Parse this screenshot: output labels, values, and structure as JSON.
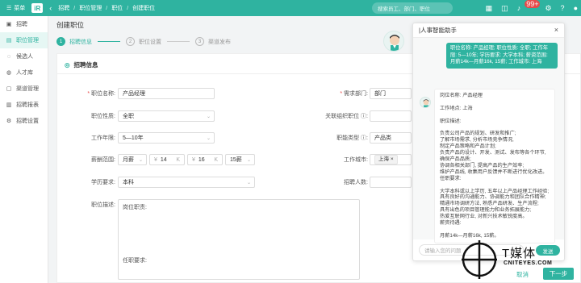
{
  "topbar": {
    "menu_label": "菜单",
    "logo_text": "iR",
    "breadcrumbs": [
      "招聘",
      "职位管理",
      "职位",
      "创建职位"
    ],
    "search_placeholder": "搜索员工、部门、职位",
    "notification_count": "99+"
  },
  "sidebar": {
    "items": [
      {
        "label": "招聘",
        "icon": "briefcase-icon"
      },
      {
        "label": "职位管理",
        "icon": "document-icon",
        "active": true
      },
      {
        "label": "候选人",
        "icon": "user-icon"
      },
      {
        "label": "人才库",
        "icon": "users-icon"
      },
      {
        "label": "渠道管理",
        "icon": "channel-icon"
      },
      {
        "label": "招聘报表",
        "icon": "chart-icon"
      },
      {
        "label": "招聘设置",
        "icon": "gear-icon"
      }
    ]
  },
  "page": {
    "title": "创建职位",
    "steps": [
      {
        "num": "1",
        "label": "招聘信息"
      },
      {
        "num": "2",
        "label": "职位设置"
      },
      {
        "num": "3",
        "label": "渠道发布"
      }
    ]
  },
  "form": {
    "section_title": "招聘信息",
    "job_name": {
      "label": "职位名称:",
      "value": "产品经理"
    },
    "department": {
      "label": "需求部门:",
      "value": "部门"
    },
    "job_nature": {
      "label": "职位性质:",
      "value": "全职"
    },
    "related_org": {
      "label": "关联组织职位",
      "value": ""
    },
    "experience": {
      "label": "工作年限:",
      "value": "5—10年"
    },
    "job_type": {
      "label": "职能类型",
      "value": "产品类"
    },
    "salary": {
      "label": "薪酬范围:",
      "period": "月薪",
      "min": "14",
      "min_unit": "K",
      "max": "16",
      "max_unit": "K",
      "months": "15薪",
      "currency": "¥"
    },
    "city": {
      "label": "工作城市:",
      "value": "上海"
    },
    "education": {
      "label": "学历要求:",
      "value": "本科"
    },
    "headcount": {
      "label": "招聘人数:",
      "value": ""
    },
    "description": {
      "label": "职位描述:",
      "line1": "岗位职责:",
      "line2": "任职要求:"
    }
  },
  "assistant": {
    "title": "|人事智能助手",
    "user_message": "职位名称: 产品经理; 职位性质: 全职; 工作年限: 5—10年; 学历要求: 大学本科; 薪资范围: 月薪14k—月薪16k, 15薪; 工作城市: 上海",
    "reply_lines": [
      "岗位名称: 产品经理",
      "",
      "工作地点: 上海",
      "",
      "职位描述:",
      "",
      "负责公司产品的规划、研发和推广;",
      "了解市场需求, 分析市场竞争情况,",
      "制定产品策略和产品计划;",
      "负责产品的设计、开发、测试、发布等各个环节,",
      "确保产品品质;",
      "协调各相关部门, 提高产品的生产效率;",
      "维护产品线, 收集用户反馈并不断进行优化改进。",
      "任职要求:",
      "",
      "大学本科或以上学历, 五年以上产品经理工作经验;",
      "具有良好的沟通能力、协调能力和团队合作精神;",
      "精通市场调研方法, 熟悉产品研发、生产流程;",
      "具有出色的项目管理能力和业务拓展能力;",
      "热爱互联网行业, 对新兴技术敏锐度高。",
      "薪资待遇:",
      "",
      "月薪14k—月薪16k, 15薪。"
    ],
    "input_placeholder": "请输入您的问题",
    "send_label": "发送"
  },
  "watermark": {
    "word": "T媒体",
    "url": "CNITEYES.COM"
  },
  "footer": {
    "cancel_label": "取消",
    "next_label": "下一步"
  },
  "colors": {
    "brand": "#2fb3a0",
    "required": "#e84a4a"
  }
}
